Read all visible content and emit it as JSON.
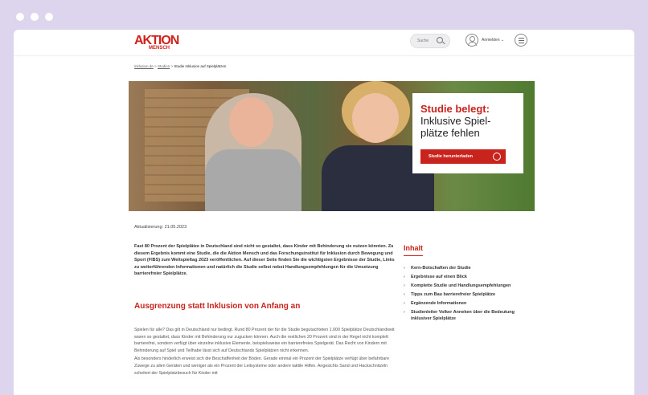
{
  "header": {
    "logo_line1": "AKTION",
    "logo_line2": "MENSCH",
    "search_label": "Suche",
    "login_label": "Anmelden ⌄"
  },
  "breadcrumb": {
    "items": [
      "inklusion.de",
      "Studien",
      "Studie Inklusion auf Spielplätzen"
    ],
    "separator": ">"
  },
  "hero": {
    "title_red": "Studie belegt:",
    "title_dark": "Inklusive Spiel-plätze fehlen",
    "button_label": "Studie herunterladen"
  },
  "article": {
    "date": "Aktualisierung: 21.05.2023",
    "intro": "Fast 80 Prozent der Spielplätze in Deutschland sind nicht so gestaltet, dass Kinder mit Behinderung sie nutzen könnten. Zu diesem Ergebnis kommt eine Studie, die die Aktion Mensch und das Forschungs­institut für Inklusion durch Bewegung und Sport (FIBS) zum Weltspieltag 2023 veröffentlichen. Auf dieser Seite finden Sie die wichtigsten Ergebnisse der Studie, Links zu weiterführenden Informationen und natürlich die Studie selbst nebst Handlungsempfehlungen für die Umsetzung barrierefreier Spielplätze.",
    "heading": "Ausgrenzung statt Inklusion von Anfang an",
    "para1": "Spielen für alle? Das gilt in Deutschland nur bedingt. Rund 80 Prozent der für die Studie begutachteten 1.000 Spielplätze Deutschlandweit waren so gestaltet, dass Kinder mit Behinderung nur zugucken können. Auch die restlichen 20 Prozent sind in der Regel nicht komplett barrierefrei, sondern verfügt über einzelne inklusive Elemente, beispielsweise ein barrierefreies Spielgerät. Das Recht von Kindern mit Behinderung auf Spiel und Teilhabe lässt sich auf Deutschlands Spielplätzen nicht erkennen.",
    "para2": "Als besonders hinderlich erweist sich die Beschaffenheit der Böden. Gerade einmal ein Prozent der Spielplätze verfügt über befahrbare Zuwege zu allen Geräten und weniger als ein Prozent der Leitsysteme oder andere taktile Hilfen. Angesichts Sand und Hackschnitzeln scheitert der Spielplatzbesuch für Kinder mit"
  },
  "toc": {
    "title": "Inhalt",
    "items": [
      "Kern-Botschaften der Studie",
      "Ergebnisse auf einen Blick",
      "Komplette Studie und Handlungsempfehlungen",
      "Tipps zum Bau barrierefreier Spielplätze",
      "Ergänzende Informationen",
      "Studienleiter Volker Anneken über die Bedeutung inklusiver Spielplätze"
    ]
  },
  "colors": {
    "accent": "#c9231d",
    "frame": "#ddd4ee"
  }
}
